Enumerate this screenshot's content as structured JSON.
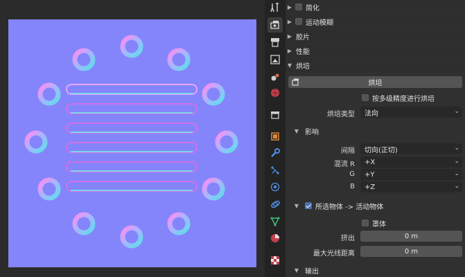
{
  "viewport": {
    "name": "normal-map-baked-image"
  },
  "tabs": [
    {
      "icon": "tool-icon",
      "active": false
    },
    {
      "icon": "render-icon",
      "active": true
    },
    {
      "icon": "output-icon",
      "active": false
    },
    {
      "icon": "view-layer-icon",
      "active": false
    },
    {
      "icon": "scene-icon",
      "active": false
    },
    {
      "icon": "world-icon",
      "active": false
    },
    {
      "icon": "collection-icon",
      "active": false
    },
    {
      "icon": "object-icon",
      "active": false
    },
    {
      "icon": "modifier-icon",
      "active": false
    },
    {
      "icon": "particles-icon",
      "active": false
    },
    {
      "icon": "physics-icon",
      "active": false
    },
    {
      "icon": "constraints-icon",
      "active": false
    },
    {
      "icon": "data-icon",
      "active": false
    },
    {
      "icon": "material-icon",
      "active": false
    },
    {
      "icon": "texture-icon",
      "active": false
    }
  ],
  "panels": {
    "simplify": "简化",
    "motion_blur": "运动模糊",
    "film": "胶片",
    "performance": "性能",
    "bake": "烘培"
  },
  "bake": {
    "bake_button": "烘培",
    "multires_label": "按多级精度进行烘培",
    "bake_type_label": "烘培类型",
    "bake_type_value": "法向"
  },
  "influence": {
    "header": "影响",
    "space_label": "间隔",
    "space_value": "切向(正切)",
    "swizzle_r_label": "混流 R",
    "swizzle_r_value": "+X",
    "g_label": "G",
    "g_value": "+Y",
    "b_label": "B",
    "b_value": "+Z"
  },
  "selected_to_active": {
    "header": "所选物体 -> 活动物体",
    "checked": true,
    "cage_label": "罩体",
    "extrusion_label": "挤出",
    "extrusion_value": "0 m",
    "max_ray_label": "最大光线距离",
    "max_ray_value": "0 m"
  },
  "output": {
    "header": "输出"
  },
  "colors": {
    "accent": "#4772b3",
    "normal_base": "#8080ff",
    "panel": "#303030"
  }
}
